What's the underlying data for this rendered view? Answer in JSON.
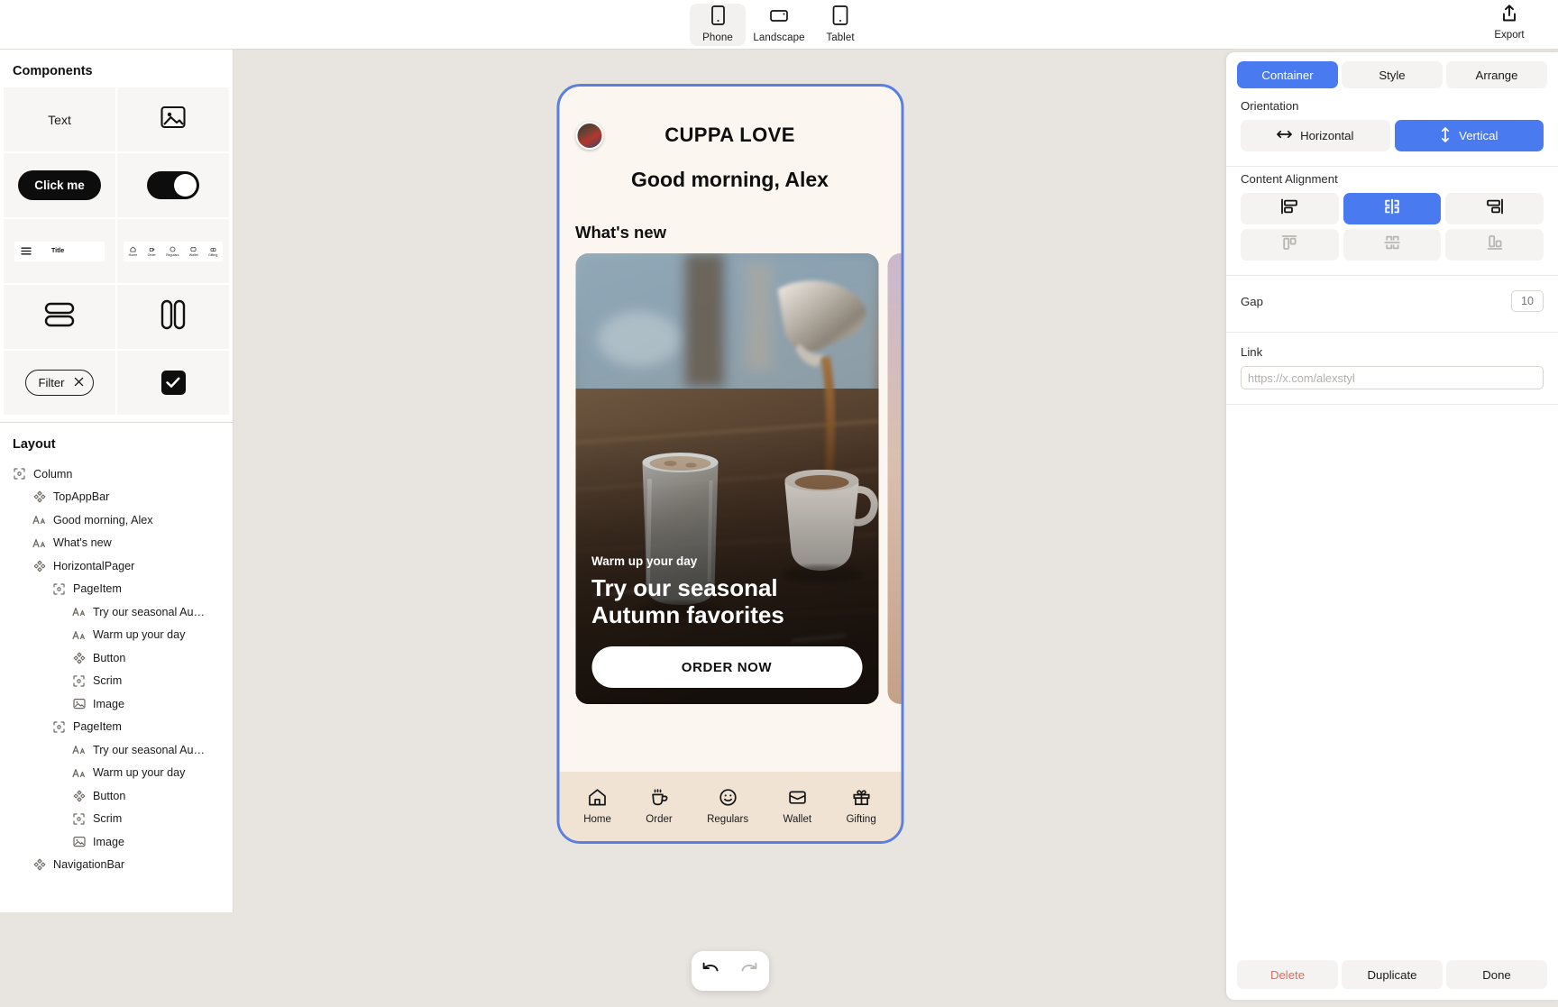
{
  "topbar": {
    "devices": [
      {
        "label": "Phone",
        "icon": "phone-portrait-icon",
        "active": true
      },
      {
        "label": "Landscape",
        "icon": "phone-landscape-icon",
        "active": false
      },
      {
        "label": "Tablet",
        "icon": "tablet-icon",
        "active": false
      }
    ],
    "export_label": "Export",
    "export_icon": "share-upload-icon"
  },
  "left_panel": {
    "components_title": "Components",
    "components": [
      {
        "name": "text",
        "label": "Text",
        "icon": "text-component"
      },
      {
        "name": "image",
        "label": "",
        "icon": "image-icon"
      },
      {
        "name": "button",
        "label": "Click me",
        "icon": "button-component"
      },
      {
        "name": "switch",
        "label": "",
        "icon": "toggle-switch-icon"
      },
      {
        "name": "topappbar",
        "label": "Title",
        "icon": "top-app-bar-component"
      },
      {
        "name": "navigationbar",
        "label": "",
        "icon": "navigation-bar-component"
      },
      {
        "name": "column",
        "label": "",
        "icon": "column-layout-icon"
      },
      {
        "name": "row",
        "label": "",
        "icon": "row-layout-icon"
      },
      {
        "name": "chip",
        "label": "Filter",
        "icon": "filter-chip-component"
      },
      {
        "name": "checkbox",
        "label": "",
        "icon": "checkbox-icon"
      }
    ],
    "navbar_preview_items": [
      "Home",
      "Order",
      "Regulars",
      "Wallet",
      "Gifting"
    ],
    "layout_title": "Layout",
    "tree": [
      {
        "label": "Column",
        "icon": "container-icon",
        "depth": 0
      },
      {
        "label": "TopAppBar",
        "icon": "component-icon",
        "depth": 1
      },
      {
        "label": "Good morning, Alex",
        "icon": "text-icon",
        "depth": 1
      },
      {
        "label": "What's new",
        "icon": "text-icon",
        "depth": 1
      },
      {
        "label": "HorizontalPager",
        "icon": "component-icon",
        "depth": 1
      },
      {
        "label": "PageItem",
        "icon": "container-icon",
        "depth": 2
      },
      {
        "label": "Try our seasonal Au…",
        "icon": "text-icon",
        "depth": 3
      },
      {
        "label": "Warm up your day",
        "icon": "text-icon",
        "depth": 3
      },
      {
        "label": "Button",
        "icon": "component-icon",
        "depth": 3
      },
      {
        "label": "Scrim",
        "icon": "container-icon",
        "depth": 3
      },
      {
        "label": "Image",
        "icon": "image-icon",
        "depth": 3
      },
      {
        "label": "PageItem",
        "icon": "container-icon",
        "depth": 2
      },
      {
        "label": "Try our seasonal Au…",
        "icon": "text-icon",
        "depth": 3
      },
      {
        "label": "Warm up your day",
        "icon": "text-icon",
        "depth": 3
      },
      {
        "label": "Button",
        "icon": "component-icon",
        "depth": 3
      },
      {
        "label": "Scrim",
        "icon": "container-icon",
        "depth": 3
      },
      {
        "label": "Image",
        "icon": "image-icon",
        "depth": 3
      },
      {
        "label": "NavigationBar",
        "icon": "component-icon",
        "depth": 1
      }
    ]
  },
  "preview": {
    "app_title": "CUPPA LOVE",
    "greeting": "Good morning, Alex",
    "section_title": "What's new",
    "cards": [
      {
        "kicker": "Warm up your day",
        "headline_line1": "Try our seasonal",
        "headline_line2": "Autumn favorites",
        "cta": "ORDER NOW"
      }
    ],
    "nav_items": [
      {
        "label": "Home",
        "icon": "home-icon"
      },
      {
        "label": "Order",
        "icon": "coffee-cup-icon"
      },
      {
        "label": "Regulars",
        "icon": "smiley-face-icon"
      },
      {
        "label": "Wallet",
        "icon": "wallet-icon"
      },
      {
        "label": "Gifting",
        "icon": "gift-icon"
      }
    ]
  },
  "canvas": {
    "undo_icon": "undo-arrow-icon",
    "redo_icon": "redo-arrow-icon"
  },
  "inspector": {
    "tabs": [
      {
        "label": "Container",
        "active": true
      },
      {
        "label": "Style",
        "active": false
      },
      {
        "label": "Arrange",
        "active": false
      }
    ],
    "orientation_label": "Orientation",
    "orientation_options": [
      {
        "label": "Horizontal",
        "icon": "horizontal-arrows-icon",
        "active": false
      },
      {
        "label": "Vertical",
        "icon": "vertical-arrows-icon",
        "active": true
      }
    ],
    "alignment_label": "Content Alignment",
    "alignment_options": [
      {
        "name": "align-start",
        "active": false
      },
      {
        "name": "align-center-horizontal",
        "active": true
      },
      {
        "name": "align-end",
        "active": false
      },
      {
        "name": "align-top",
        "active": false
      },
      {
        "name": "align-center-vertical",
        "active": false
      },
      {
        "name": "align-bottom",
        "active": false
      }
    ],
    "gap_label": "Gap",
    "gap_value": "10",
    "link_label": "Link",
    "link_value": "",
    "link_placeholder": "https://x.com/alexstyl",
    "footer": [
      {
        "label": "Delete",
        "danger": true
      },
      {
        "label": "Duplicate",
        "danger": false
      },
      {
        "label": "Done",
        "danger": false
      }
    ]
  },
  "colors": {
    "accent": "#4a7af0",
    "canvas_bg": "#e8e4e0",
    "phone_bg": "#fbf7f0",
    "navbar_bg": "#f1e3d4",
    "danger": "#e8685e"
  }
}
